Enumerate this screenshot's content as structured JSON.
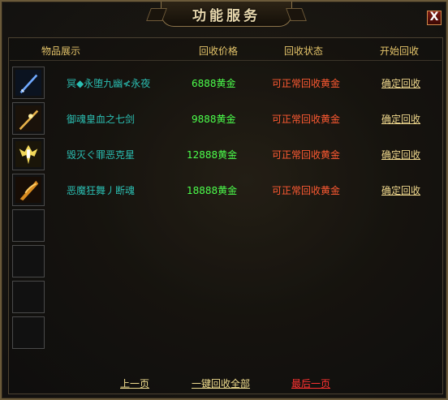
{
  "window": {
    "title": "功能服务",
    "close_label": "X"
  },
  "columns": {
    "display": "物品展示",
    "price": "回收价格",
    "status": "回收状态",
    "start": "开始回收"
  },
  "rows": [
    {
      "name": "冥◆永堕九幽≮永夜",
      "price": "6888黄金",
      "status": "可正常回收黄金",
      "action": "确定回收",
      "icon": "blue-sword-icon",
      "color": "#2b65c9"
    },
    {
      "name": "御魂皇血之七剑",
      "price": "9888黄金",
      "status": "可正常回收黄金",
      "action": "确定回收",
      "icon": "gold-sword-icon",
      "color": "#d7a13b"
    },
    {
      "name": "毁灭ぐ罪恶克星",
      "price": "12888黄金",
      "status": "可正常回收黄金",
      "action": "确定回收",
      "icon": "winged-armor-icon",
      "color": "#e8cf58"
    },
    {
      "name": "恶魔狂舞丿断魂",
      "price": "18888黄金",
      "status": "可正常回收黄金",
      "action": "确定回收",
      "icon": "flame-blade-icon",
      "color": "#cf8a1f"
    }
  ],
  "pagination": {
    "prev": "上一页",
    "recycle_all": "一键回收全部",
    "last": "最后一页"
  }
}
